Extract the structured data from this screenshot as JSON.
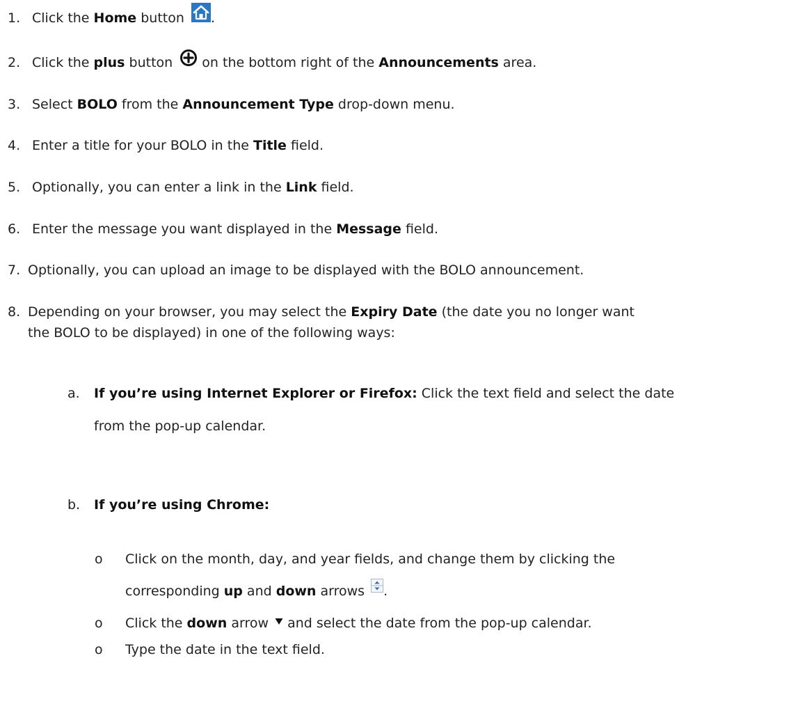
{
  "steps": [
    {
      "n": "1.",
      "t1": "Click the ",
      "b1": "Home",
      "t2": " button",
      "t3": "."
    },
    {
      "n": "2.",
      "t1": "Click the ",
      "b1": "plus",
      "t2": " button",
      "t3": " on the bottom right of the ",
      "b2": "Announcements",
      "t4": " area."
    },
    {
      "n": "3.",
      "t1": "Select ",
      "b1": "BOLO",
      "t2": " from the ",
      "b2": "Announcement Type",
      "t3": " drop-down menu."
    },
    {
      "n": "4.",
      "t1": "Enter a title for your BOLO in the ",
      "b1": "Title",
      "t2": " field."
    },
    {
      "n": "5.",
      "t1": "Optionally, you can enter a link in the ",
      "b1": "Link",
      "t2": " field."
    },
    {
      "n": "6.",
      "t1": "Enter the message you want displayed in the ",
      "b1": "Message",
      "t2": " field."
    },
    {
      "n": "7.",
      "t1": "Optionally, you can upload an image to be displayed with the BOLO announcement."
    },
    {
      "n": "8.",
      "t1": "Depending on your browser, you may select the ",
      "b1": "Expiry Date",
      "t2": " (the date you no longer want",
      "t3": "the BOLO to be displayed) in one of the following ways:"
    }
  ],
  "sub_a": {
    "n": "a.",
    "b1": "If you’re using Internet Explorer or Firefox:",
    "t1": " Click the text field and select the date",
    "t2": "from the pop-up calendar."
  },
  "sub_b": {
    "n": "b.",
    "b1": "If you’re using Chrome:"
  },
  "bullets": [
    {
      "m": "o",
      "t1": "Click on the month, day, and year fields, and change them by clicking the",
      "t2": "corresponding ",
      "b1": "up",
      "t3": " and ",
      "b2": "down",
      "t4": " arrows",
      "t5": "."
    },
    {
      "m": "o",
      "t1": "Click the ",
      "b1": "down",
      "t2": " arrow",
      "t3": " and select the date from the pop-up calendar."
    },
    {
      "m": "o",
      "t1": "Type the date in the text field."
    }
  ],
  "icons": {
    "home": "home-icon",
    "plus": "plus-circle-icon",
    "spinner": "up-down-arrows-icon",
    "dropdown": "down-arrow-icon"
  },
  "colors": {
    "home_icon": "#2a78c4",
    "plus_icon": "#111111",
    "text": "#222222"
  }
}
